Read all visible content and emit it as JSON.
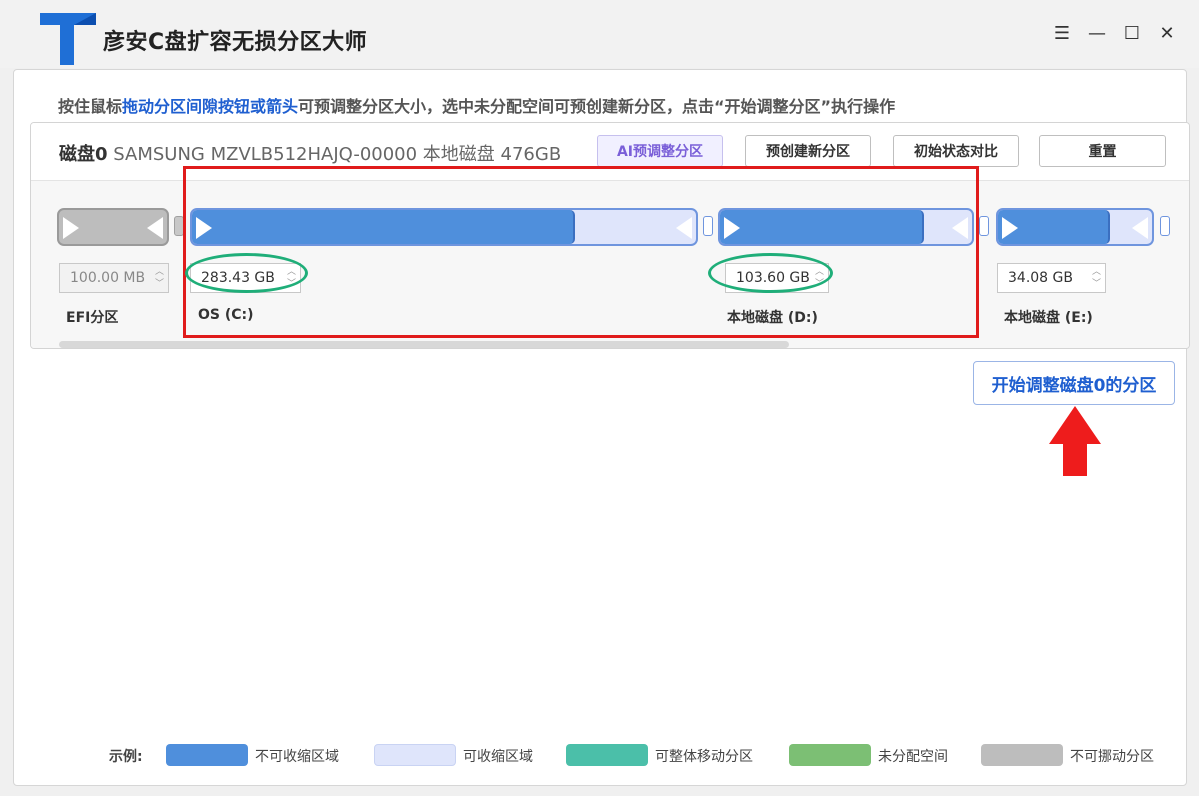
{
  "app": {
    "title": "彦安C盘扩容无损分区大师"
  },
  "window_controls": {
    "menu": "☰",
    "minimize": "—",
    "maximize": "☐",
    "close": "✕"
  },
  "instruction": {
    "part1": "按住鼠标",
    "highlight": "拖动分区间隙按钮或箭头",
    "part2": "可预调整分区大小，选中未分配空间可预创建新分区，点击“开始调整分区”执行操作"
  },
  "disk": {
    "name": "磁盘0",
    "info": " SAMSUNG MZVLB512HAJQ-00000 本地磁盘 476GB",
    "buttons": {
      "ai_adjust": "AI预调整分区",
      "precreate": "预创建新分区",
      "compare": "初始状态对比",
      "reset": "重置"
    }
  },
  "partitions": [
    {
      "name": "EFI分区",
      "size": "100.00 MB",
      "kind": "unmovable"
    },
    {
      "name": "OS (C:)",
      "size": "283.43 GB",
      "kind": "resizable",
      "used_fraction": 0.76
    },
    {
      "name": "本地磁盘 (D:)",
      "size": "103.60 GB",
      "kind": "resizable",
      "used_fraction": 0.81
    },
    {
      "name": "本地磁盘 (E:)",
      "size": "34.08 GB",
      "kind": "resizable",
      "used_fraction": 0.73
    }
  ],
  "start_button": "开始调整磁盘0的分区",
  "legend": {
    "label": "示例:",
    "items": [
      {
        "text": "不可收缩区域",
        "color": "#4f8fdc"
      },
      {
        "text": "可收缩区域",
        "color": "#dfe5fb"
      },
      {
        "text": "可整体移动分区",
        "color": "#4bbfa9"
      },
      {
        "text": "未分配空间",
        "color": "#7cbf74"
      },
      {
        "text": "不可挪动分区",
        "color": "#bdbdbd"
      }
    ]
  },
  "colors": {
    "accent": "#1f5fd0",
    "annotation_red": "#e01b1b",
    "annotation_green": "#1fae79"
  }
}
